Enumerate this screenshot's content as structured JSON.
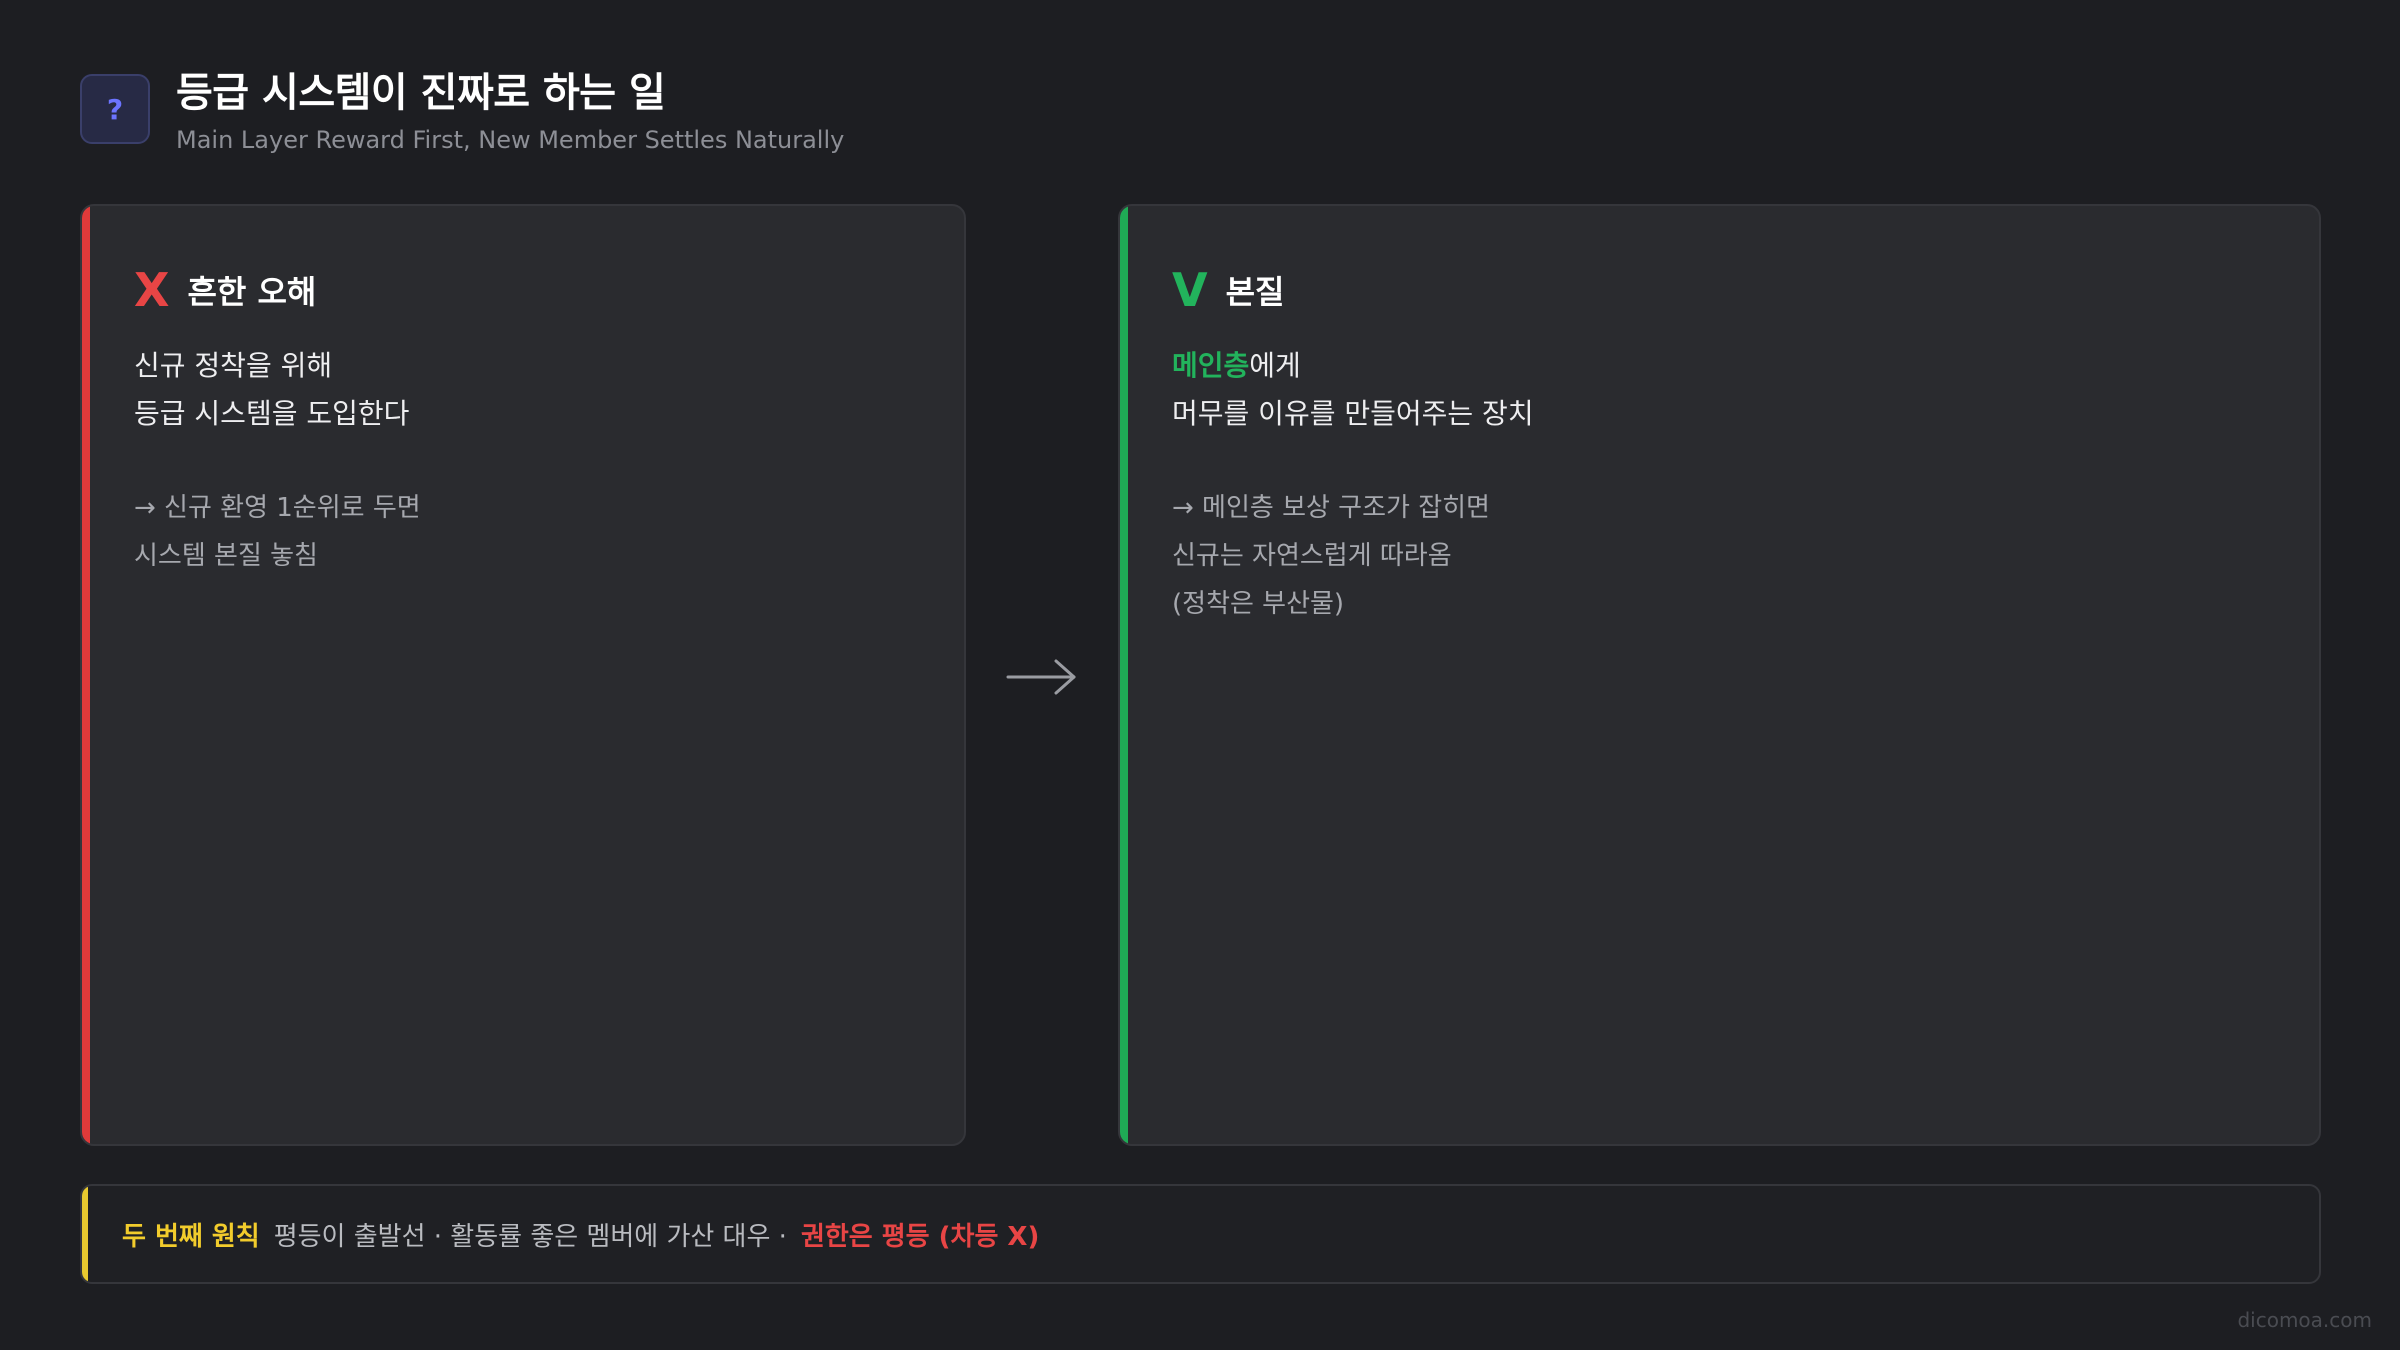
{
  "header": {
    "icon_name": "question-icon",
    "icon_glyph": "?",
    "title": "등급 시스템이 진짜로 하는 일",
    "subtitle": "Main Layer Reward First, New Member Settles Naturally"
  },
  "left_card": {
    "mark": "X",
    "title": "흔한 오해",
    "body_line1": "신규 정착을 위해",
    "body_line2": "등급 시스템을 도입한다",
    "note_line1": "→ 신규 환영 1순위로 두면",
    "note_line2": "시스템 본질 놓침",
    "accent_color": "#e03a3a"
  },
  "arrow_icon": "arrow-right-icon",
  "right_card": {
    "mark": "V",
    "title": "본질",
    "body_highlight": "메인층",
    "body_line1_rest": "에게",
    "body_line2": "머무를 이유를 만들어주는 장치",
    "note_line1": "→ 메인층 보상 구조가 잡히면",
    "note_line2": "신규는 자연스럽게 따라옴",
    "note_line3": "(정착은 부산물)",
    "accent_color": "#1faa55"
  },
  "footer": {
    "label": "두 번째 원칙",
    "text": "평등이 출발선 · 활동률 좋은 멤버에 가산 대우 ·",
    "emphasis": "권한은 평등 (차등 X)",
    "accent_color": "#e8c92f"
  },
  "watermark": "dicomoa.com"
}
